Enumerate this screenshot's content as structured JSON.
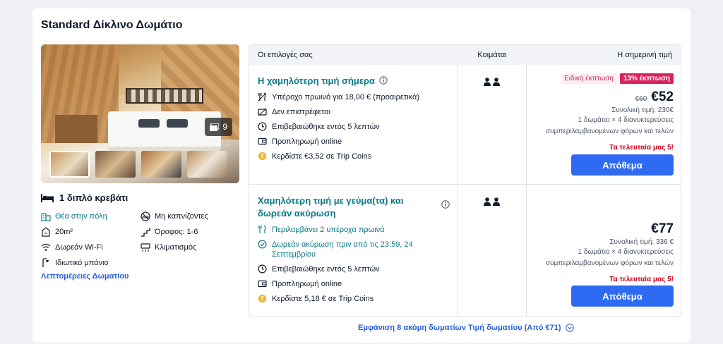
{
  "room": {
    "title": "Standard Δίκλινο Δωμάτιο",
    "photo_count": "9",
    "bed": "1 διπλό κρεβάτι",
    "amenities": [
      {
        "label": "Θέα στην πόλη",
        "icon": "city-view-icon",
        "highlight": true
      },
      {
        "label": "Μη καπνίζοντες",
        "icon": "no-smoking-icon",
        "highlight": false
      },
      {
        "label": "20m²",
        "icon": "area-icon",
        "highlight": false
      },
      {
        "label": "Όροφος: 1-6",
        "icon": "floor-icon",
        "highlight": false
      },
      {
        "label": "Δωρεάν Wi-Fi",
        "icon": "wifi-icon",
        "highlight": false
      },
      {
        "label": "Κλιματισμός",
        "icon": "air-conditioning-icon",
        "highlight": false
      },
      {
        "label": "Ιδιωτικό μπάνιο",
        "icon": "shower-icon",
        "highlight": false
      }
    ],
    "details_link": "Λεπτομέρειες Δωματίου"
  },
  "table": {
    "headers": {
      "options": "Οι επιλογές σας",
      "sleeps": "Κοιμάται",
      "price": "Η σημερινή τιμή"
    },
    "offers": [
      {
        "title": "Η χαμηλότερη τιμή σήμερα",
        "features": [
          {
            "text": "Υπέροχο πρωινό για 18,00 € (προαιρετικά)",
            "icon": "breakfast-icon",
            "highlight": false
          },
          {
            "text": "Δεν επιστρέφεται",
            "icon": "non-refundable-icon",
            "highlight": false
          },
          {
            "text": "Επιβεβαιώθηκε εντός 5 λεπτών",
            "icon": "clock-icon",
            "highlight": false
          },
          {
            "text": "Προπληρωμή online",
            "icon": "wallet-icon",
            "highlight": false
          },
          {
            "text": "Κερδίστε €3,52 σε Trip Coins",
            "icon": "coin-icon",
            "highlight": false
          }
        ],
        "badge_soft": "Ειδική έκπτωση",
        "badge_hot": "13% έκπτωση",
        "old_price": "€60",
        "price": "€52",
        "total": "Συνολική τιμή: 230€",
        "sub_line1": "1 δωμάτιο × 4 διανυκτερεύσεις",
        "sub_line2": "συμπεριλαμβανομένων φόρων και τελών",
        "urgency": "Τα τελευταία μας 5!",
        "button": "Απόθεμα"
      },
      {
        "title": "Χαμηλότερη τιμή με γεύμα(τα) και δωρεάν ακύρωση",
        "features": [
          {
            "text": "Περιλαμβάνει 2 υπέροχα πρωινά",
            "icon": "breakfast-icon",
            "highlight": true
          },
          {
            "text": "Δωρεάν ακύρωση πριν από τις 23:59, 24 Σεπτεμβρίου",
            "icon": "check-circle-icon",
            "highlight": true
          },
          {
            "text": "Επιβεβαιώθηκε εντός 5 λεπτών",
            "icon": "clock-icon",
            "highlight": false
          },
          {
            "text": "Προπληρωμή online",
            "icon": "wallet-icon",
            "highlight": false
          },
          {
            "text": "Κερδίστε 5,18 € σε Trip Coins",
            "icon": "coin-icon",
            "highlight": false
          }
        ],
        "price": "€77",
        "total": "Συνολική τιμή: 336 €",
        "sub_line1": "1 δωμάτιο × 4 διανυκτερεύσεις",
        "sub_line2": "συμπεριλαμβανομένων φόρων και τελών",
        "urgency": "Τα τελευταία μας 5!",
        "button": "Απόθεμα"
      }
    ]
  },
  "more_link": "Εμφάνιση 8 ακόμη δωματίων Τιμή δωματίου (Από €71)",
  "colors": {
    "accent": "#2f6bf2",
    "teal": "#0e7a8a",
    "discount": "#d6245c",
    "urgency": "#d0021b"
  }
}
